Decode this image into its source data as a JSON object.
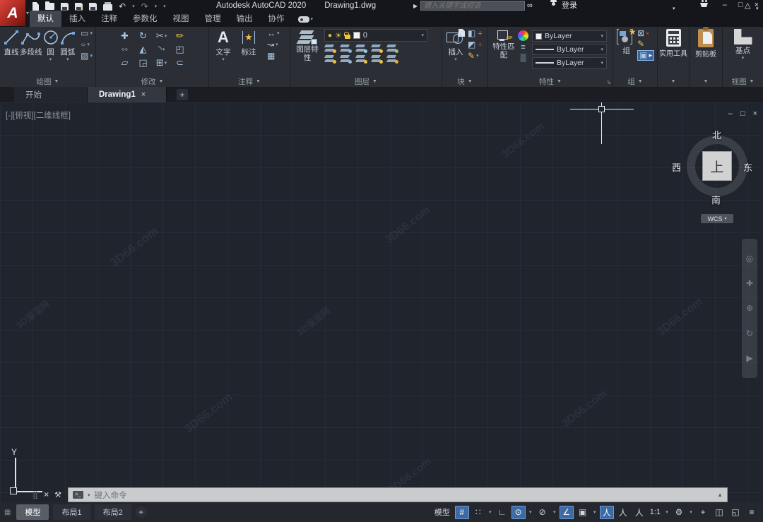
{
  "titlebar": {
    "app_title": "Autodesk AutoCAD 2020",
    "doc_title": "Drawing1.dwg",
    "search_placeholder": "键入关键字或短语",
    "signin": "登录"
  },
  "ribbon_tabs": [
    "默认",
    "插入",
    "注释",
    "参数化",
    "视图",
    "管理",
    "输出",
    "协作"
  ],
  "panels": {
    "draw": {
      "label": "绘图",
      "line": "直线",
      "pline": "多段线",
      "circle": "圆",
      "arc": "圆弧"
    },
    "modify": {
      "label": "修改"
    },
    "annotate": {
      "label": "注释",
      "text": "文字",
      "dim": "标注"
    },
    "layers": {
      "label": "图层",
      "props": "图层特性",
      "layer_name": "0"
    },
    "block": {
      "label": "块",
      "insert": "插入"
    },
    "properties": {
      "label": "特性",
      "match": "特性匹配",
      "color_value": "ByLayer",
      "lineweight_value": "ByLayer",
      "linetype_value": "ByLayer"
    },
    "groups": {
      "label": "组",
      "group_btn": "组"
    },
    "utilities": {
      "label": "实用工具"
    },
    "clipboard": {
      "label": "剪贴板"
    },
    "view": {
      "label": "视图",
      "base": "基点"
    }
  },
  "file_tabs": {
    "start": "开始",
    "drawing1": "Drawing1"
  },
  "viewport": {
    "label": "[-][俯视][二维线框]",
    "ucs_y": "Y",
    "viewcube": {
      "north": "北",
      "south": "南",
      "west": "西",
      "east": "东",
      "top": "上"
    },
    "wcs": "WCS"
  },
  "command": {
    "prompt": "键入命令"
  },
  "statusbar": {
    "model_tab": "模型",
    "layout1": "布局1",
    "layout2": "布局2",
    "add": "+",
    "model_btn": "模型",
    "scale": "1:1"
  },
  "watermarks": [
    "3D溜溜网",
    "3D66.com",
    "3D66.com",
    "3D66.com",
    "3D66.com",
    "3D66.com",
    "3D66.com",
    "3D溜溜网",
    "3D66.com"
  ],
  "colors": {
    "accent_blue": "#3e6aa3",
    "highlight_yellow": "#f0c040",
    "logo_red": "#b02c24",
    "canvas_bg": "#20242c",
    "ribbon_bg": "#2b2e35"
  },
  "icons": {
    "logo_letter": "A",
    "dropdown": "▾",
    "panel_down": "▼",
    "launcher": "⇘",
    "undo": "↶",
    "redo": "↷",
    "qat_more": "▾",
    "search_go": "▶",
    "binoculars": "∞",
    "app_store": "△",
    "help": "?",
    "minimize": "–",
    "maximize": "□",
    "close": "×",
    "vp_min": "–",
    "vp_restore": "□",
    "vp_close": "×",
    "tab_close": "×",
    "tab_new": "+",
    "move": "✚",
    "rotate": "↻",
    "trim": "✂",
    "erase": "✏",
    "copy": "◦◦",
    "mirror": "◭",
    "fillet": "◝",
    "explode": "◰",
    "stretch": "▱",
    "scale": "◲",
    "array": "⊞",
    "offset": "⊂",
    "rect": "▭",
    "ellipse": "○",
    "hatch": "▨",
    "text_a": "A",
    "dim_star": "★",
    "dim_linear": "↔",
    "leader": "↝",
    "table": "▦",
    "bulb": "●",
    "sun": "☀",
    "lineweight": "≡",
    "transparency": "▒",
    "blk_make": "◧",
    "blk_edit": "✎",
    "blk_attr": "◩",
    "grp_ungroup": "⊠",
    "grp_edit": "✎",
    "grp_select": "▣",
    "group_star": "★",
    "nav_wheel": "◎",
    "nav_pan": "✚",
    "nav_zoom": "⊕",
    "nav_orbit": "↻",
    "nav_motion": "▶",
    "grid": "#",
    "snap": "∷",
    "ortho": "∟",
    "polar": "⊙",
    "isodraft": "⊘",
    "otrack": "∠",
    "osnap": "▣",
    "annot_vis": "人",
    "annot_auto": "人",
    "annot_scale": "人",
    "gear": "⚙",
    "plus": "+",
    "isolate": "◫",
    "cleanscreen": "◱",
    "menu": "≡",
    "cmd_prompt": ">_",
    "cmd_up": "▲",
    "wrench": "⚒",
    "grip": "⣿",
    "xmark": "×",
    "layout_menu": "▦"
  }
}
